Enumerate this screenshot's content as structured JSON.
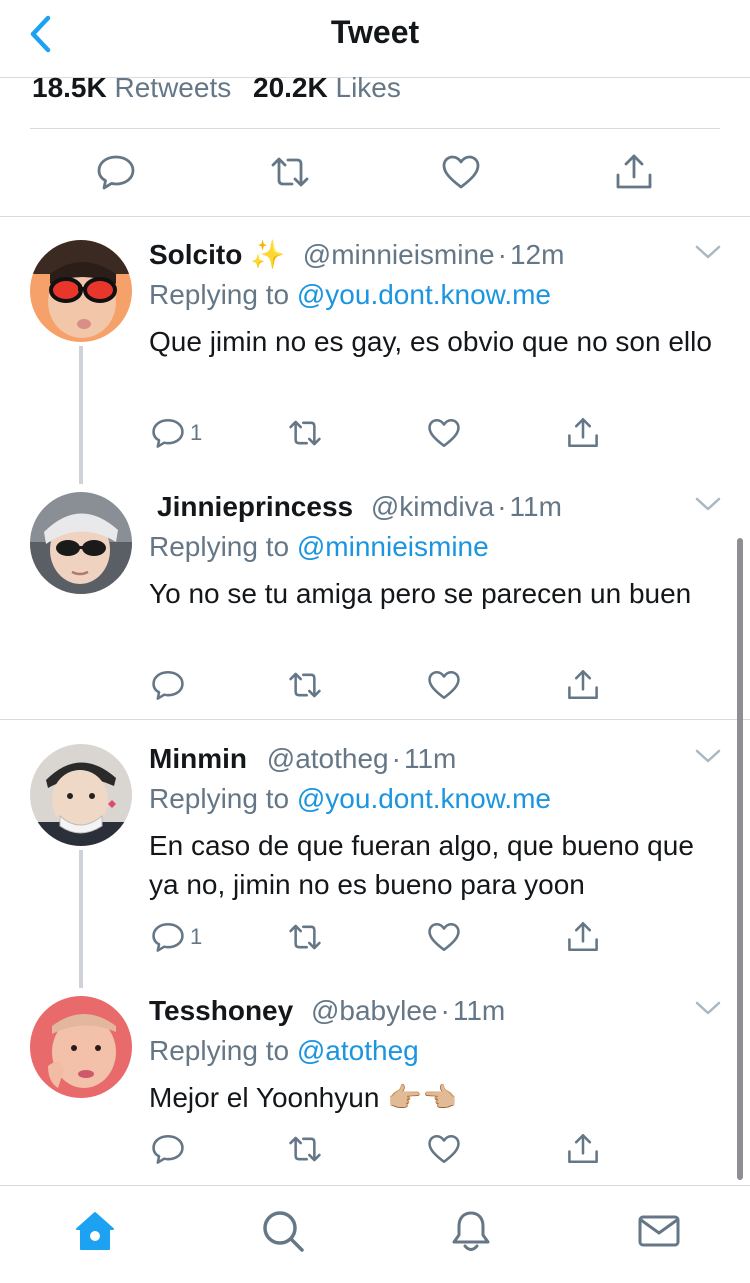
{
  "header": {
    "title": "Tweet",
    "back_icon": "chevron-left-icon"
  },
  "stats": {
    "retweets_count": "18.5K",
    "retweets_label": "Retweets",
    "likes_count": "20.2K",
    "likes_label": "Likes"
  },
  "main_actions": [
    "reply-icon",
    "retweet-icon",
    "like-icon",
    "share-icon"
  ],
  "tweets": [
    {
      "name": "Solcito",
      "name_emoji": "✨",
      "handle": "@minnieismine",
      "dot": "·",
      "time": "12m",
      "reply_prefix": "Replying to",
      "reply_to": "@you.dont.know.me",
      "body": "Que jimin no es gay, es obvio que no son ello",
      "reply_count": "1"
    },
    {
      "name": "Jinnieprincess",
      "handle": "@kimdiva",
      "dot": "·",
      "time": "11m",
      "reply_prefix": "Replying to",
      "reply_to": "@minnieismine",
      "body": "Yo no se tu amiga pero se parecen un buen",
      "reply_count": ""
    },
    {
      "name": "Minmin",
      "handle": "@atotheg",
      "dot": "·",
      "time": "11m",
      "reply_prefix": "Replying to",
      "reply_to": "@you.dont.know.me",
      "body": "En caso de que fueran algo, que bueno que ya no, jimin no es bueno para yoon",
      "reply_count": "1"
    },
    {
      "name": "Tesshoney",
      "handle": "@babylee",
      "dot": "·",
      "time": "11m",
      "reply_prefix": "Replying to",
      "reply_to": "@atotheg",
      "body": "Mejor el Yoonhyun 👉🏼👈🏼",
      "reply_count": ""
    }
  ],
  "tabbar": [
    "home-icon",
    "search-icon",
    "notifications-bell-icon",
    "messages-mail-icon"
  ],
  "colors": {
    "accent": "#1da1f2",
    "link": "#1b95e0",
    "secondary_text": "#657786",
    "divider": "#d6dbe0"
  }
}
